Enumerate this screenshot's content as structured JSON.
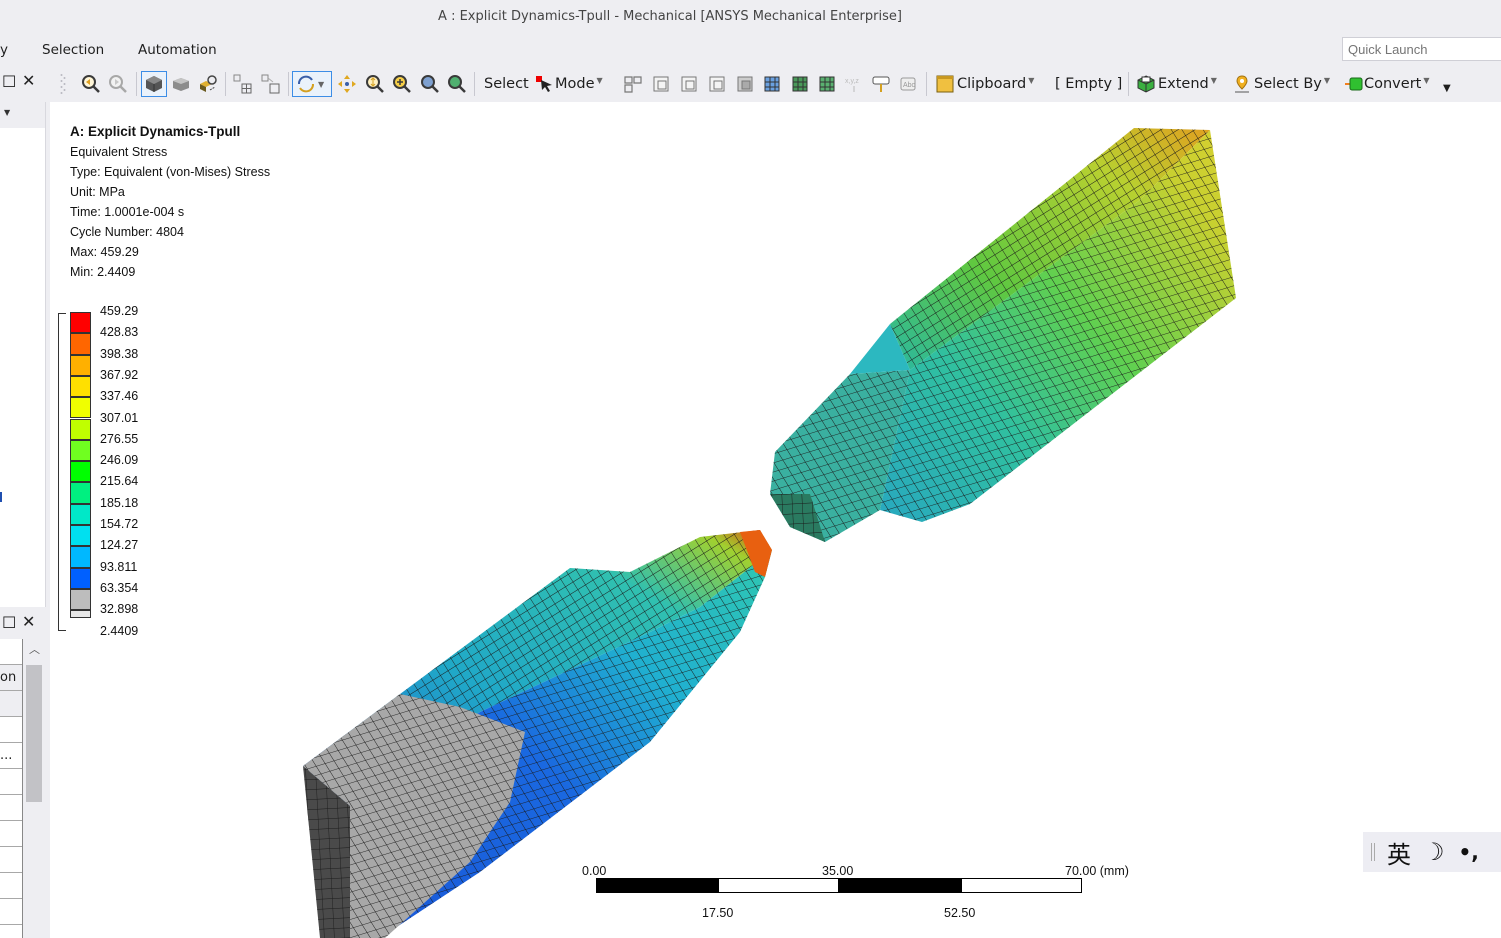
{
  "window": {
    "title": "A : Explicit Dynamics-Tpull - Mechanical [ANSYS Mechanical Enterprise]"
  },
  "menubar": {
    "items": [
      {
        "label": "y"
      },
      {
        "label": "Selection"
      },
      {
        "label": "Automation"
      }
    ],
    "quick_launch_placeholder": "Quick Launch"
  },
  "toolbar": {
    "select_label": "Select",
    "mode_label": "Mode",
    "clipboard_label": "Clipboard",
    "empty_label": "[ Empty ]",
    "extend_label": "Extend",
    "select_by_label": "Select By",
    "convert_label": "Convert",
    "icons": [
      "zoom-previous-icon",
      "zoom-next-icon",
      "isometric-view-icon",
      "shaded-view-icon",
      "render-options-icon",
      "select-grid-icon",
      "select-box-icon",
      "rotate-icon",
      "pan-icon",
      "zoom-icon",
      "zoom-in-icon",
      "zoom-to-fit-icon",
      "zoom-selection-icon",
      "mesh-select-icon",
      "face-select-icon",
      "edge-select-icon",
      "vertex-select-icon",
      "body-select-icon",
      "element-face-icon",
      "element-icon",
      "node-icon",
      "coordinate-icon",
      "label-icon",
      "annotation-icon"
    ]
  },
  "left_panel": {
    "bottom_partial_cells": [
      "",
      "on",
      "",
      "",
      "...",
      "",
      "",
      "",
      "",
      "",
      ""
    ]
  },
  "viewport": {
    "result_info": {
      "title": "A: Explicit Dynamics-Tpull",
      "result_name": "Equivalent Stress",
      "type": "Type: Equivalent (von-Mises) Stress",
      "unit": "Unit: MPa",
      "time": "Time: 1.0001e-004 s",
      "cycle": "Cycle Number: 4804",
      "max": "Max: 459.29",
      "min": "Min: 2.4409"
    },
    "legend": {
      "values": [
        "459.29",
        "428.83",
        "398.38",
        "367.92",
        "337.46",
        "307.01",
        "276.55",
        "246.09",
        "215.64",
        "185.18",
        "154.72",
        "124.27",
        "93.811",
        "63.354",
        "32.898",
        "2.4409"
      ],
      "colors": [
        "#ff0000",
        "#ff6600",
        "#ffb000",
        "#ffe000",
        "#f0ff00",
        "#c0ff00",
        "#70ff20",
        "#00ff00",
        "#00f080",
        "#00e8c8",
        "#00e0f0",
        "#00b8ff",
        "#0060ff",
        "#bdbdbd",
        "#e8e8e8"
      ]
    },
    "scale_bar": {
      "top_labels": [
        "0.00",
        "35.00",
        "70.00 (mm)"
      ],
      "bottom_labels": [
        "17.50",
        "52.50"
      ]
    }
  },
  "ime_bar": {
    "lang": "英",
    "moon": "☽",
    "punct": "•,"
  }
}
